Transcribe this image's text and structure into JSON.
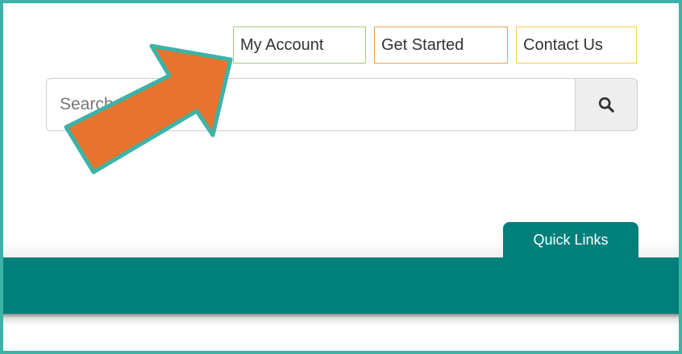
{
  "header": {
    "links": [
      {
        "label": "My Account",
        "border_color": "#a6c97a"
      },
      {
        "label": "Get Started",
        "border_color": "#f0a049"
      },
      {
        "label": "Contact Us",
        "border_color": "#f7cf4a"
      }
    ]
  },
  "search": {
    "placeholder": "Search",
    "button_icon": "search-icon"
  },
  "quick_links": {
    "label": "Quick Links"
  },
  "colors": {
    "frame": "#3bb3a6",
    "nav_bar": "#007f7b",
    "arrow_fill": "#e8732e",
    "arrow_stroke": "#3bb3a6"
  }
}
